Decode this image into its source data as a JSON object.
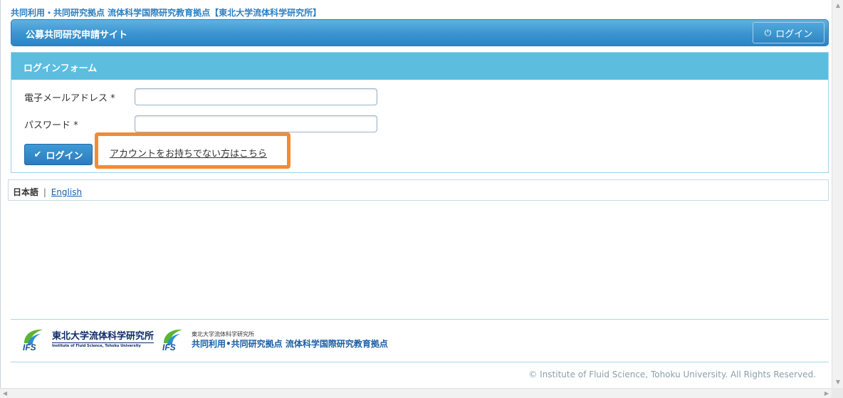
{
  "site": {
    "top_title": "共同利用・共同研究拠点 流体科学国際研究教育拠点【東北大学流体科学研究所】"
  },
  "header": {
    "title": "公募共同研究申請サイト",
    "login_label": "ログイン",
    "login_icon": "power-icon"
  },
  "login_form": {
    "heading": "ログインフォーム",
    "email_label": "電子メールアドレス *",
    "email_value": "",
    "password_label": "パスワード *",
    "password_value": "",
    "submit_label": "ログイン",
    "submit_icon": "check-icon",
    "signup_link": "アカウントをお持ちでない方はこちら",
    "highlight_color": "#f58a33"
  },
  "language": {
    "current": "日本語",
    "separator": "|",
    "other": "English"
  },
  "footer": {
    "logo1_ja": "東北大学流体科学研究所",
    "logo1_en": "Institute of Fluid Science, Tohoku University",
    "logo2_small": "東北大学流体科学研究所",
    "logo2_big": "共同利用•共同研究拠点 流体科学国際研究教育拠点",
    "copyright": "© Institute of Fluid Science, Tohoku University. All Rights Reserved."
  },
  "colors": {
    "header_blue": "#3a93cf",
    "panel_head": "#5cbddf",
    "link_blue": "#1a5fa6",
    "title_blue": "#2b7fc2"
  }
}
